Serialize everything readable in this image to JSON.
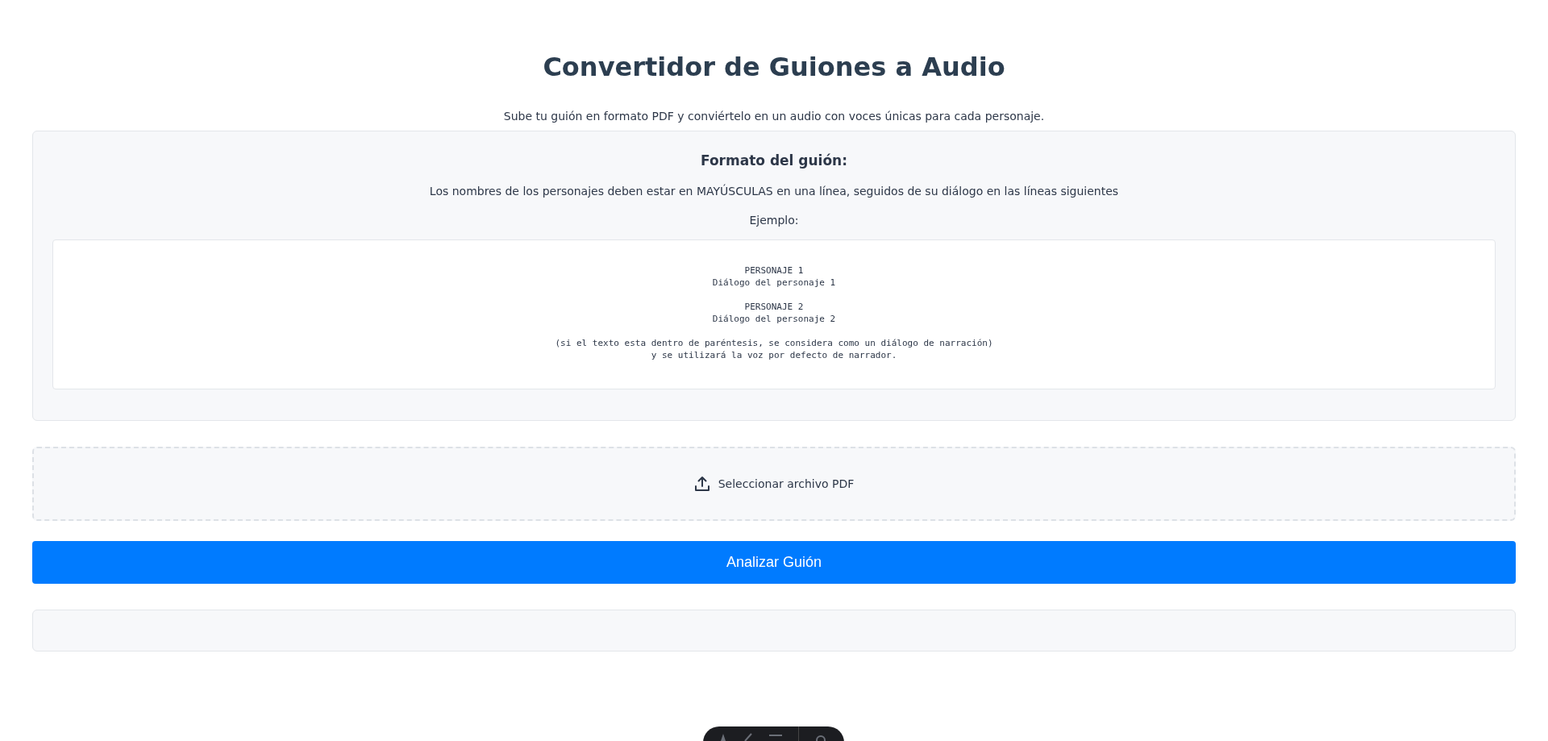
{
  "title": "Convertidor de Guiones a Audio",
  "subtitle": "Sube tu guión en formato PDF y conviértelo en un audio con voces únicas para cada personaje.",
  "format": {
    "heading": "Formato del guión:",
    "description": "Los nombres de los personajes deben estar en MAYÚSCULAS en una línea, seguidos de su diálogo en las líneas siguientes",
    "example_label": "Ejemplo:",
    "example": "PERSONAJE 1\nDiálogo del personaje 1\n\nPERSONAJE 2\nDiálogo del personaje 2\n\n(si el texto esta dentro de paréntesis, se considera como un diálogo de narración)\ny se utilizará la voz por defecto de narrador."
  },
  "upload": {
    "label": "Seleccionar archivo PDF"
  },
  "analyze_button": "Analizar Guión"
}
